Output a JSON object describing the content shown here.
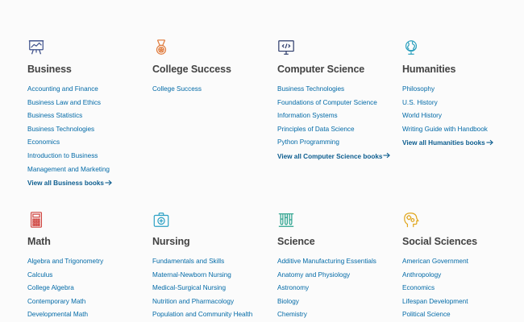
{
  "categories": [
    {
      "title": "Business",
      "icon": "presentation-board-icon",
      "books": [
        "Accounting and Finance",
        "Business Law and Ethics",
        "Business Statistics",
        "Business Technologies",
        "Economics",
        "Introduction to Business",
        "Management and Marketing"
      ],
      "view_all": "View all Business books"
    },
    {
      "title": "College Success",
      "icon": "medal-icon",
      "books": [
        "College Success"
      ]
    },
    {
      "title": "Computer Science",
      "icon": "code-monitor-icon",
      "books": [
        "Business Technologies",
        "Foundations of Computer Science",
        "Information Systems",
        "Principles of Data Science",
        "Python Programming"
      ],
      "view_all": "View all Computer Science books"
    },
    {
      "title": "Humanities",
      "icon": "globe-icon",
      "books": [
        "Philosophy",
        "U.S. History",
        "World History",
        "Writing Guide with Handbook"
      ],
      "view_all": "View all Humanities books"
    },
    {
      "title": "Math",
      "icon": "calculator-icon",
      "books": [
        "Algebra and Trigonometry",
        "Calculus",
        "College Algebra",
        "Contemporary Math",
        "Developmental Math"
      ]
    },
    {
      "title": "Nursing",
      "icon": "medical-kit-icon",
      "books": [
        "Fundamentals and Skills",
        "Maternal-Newborn Nursing",
        "Medical-Surgical Nursing",
        "Nutrition and Pharmacology",
        "Population and Community Health"
      ]
    },
    {
      "title": "Science",
      "icon": "test-tubes-icon",
      "books": [
        "Additive Manufacturing Essentials",
        "Anatomy and Physiology",
        "Astronomy",
        "Biology",
        "Chemistry"
      ]
    },
    {
      "title": "Social Sciences",
      "icon": "head-gears-icon",
      "books": [
        "American Government",
        "Anthropology",
        "Economics",
        "Lifespan Development",
        "Political Science"
      ]
    }
  ],
  "colors": {
    "link": "#026aa7",
    "view_all": "#0c5d8f",
    "title": "#424242",
    "background": "#fbfbfb",
    "icon_business": "#3c4f8a",
    "icon_college_success": "#e07a3b",
    "icon_computer_science": "#2b3a6a",
    "icon_humanities": "#2a9fbd",
    "icon_math": "#d0443f",
    "icon_nursing": "#2aa0c4",
    "icon_science": "#27a08b",
    "icon_social_sciences": "#e0a51a"
  }
}
